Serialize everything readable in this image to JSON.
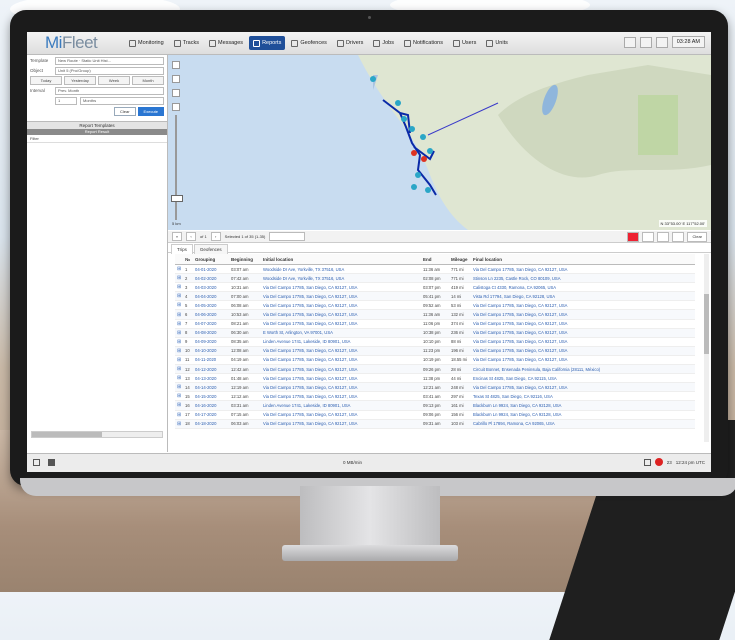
{
  "nav": {
    "logo_main": "Mi",
    "logo_tail": "Fleet",
    "items": [
      {
        "label": "Monitoring",
        "icon": "steering-wheel-icon"
      },
      {
        "label": "Tracks",
        "icon": "flag-icon"
      },
      {
        "label": "Messages",
        "icon": "messages-icon"
      },
      {
        "label": "Reports",
        "icon": "reports-icon",
        "active": true
      },
      {
        "label": "Geofences",
        "icon": "geofence-icon"
      },
      {
        "label": "Drivers",
        "icon": "drivers-icon"
      },
      {
        "label": "Jobs",
        "icon": "jobs-icon"
      },
      {
        "label": "Notifications",
        "icon": "bell-icon"
      },
      {
        "label": "Users",
        "icon": "users-icon"
      },
      {
        "label": "Units",
        "icon": "car-icon"
      }
    ],
    "clock": "03:28 AM"
  },
  "left_panel": {
    "template_label": "Template",
    "template_value": "New Route · Static Unit Hist...",
    "object_label": "Object",
    "object_value": "Unit 5 (Pro/Group)",
    "interval_label": "Interval",
    "interval_value": "Prev. Month",
    "period_buttons": [
      "Today",
      "Yesterday",
      "Week",
      "Month"
    ],
    "count_value": "1",
    "unit_value": "Months",
    "run_label": "Execute",
    "clear_label": "Clear",
    "templates_header": "Report Templates",
    "templates_sub": "Report Result",
    "filter_label": "Filter"
  },
  "map": {
    "scale": "5 km",
    "coords": "N 33°53.00' E 117°52.00'"
  },
  "grid_toolbar": {
    "page": "of 1",
    "selector": "Selected 1 of 35 (1-35)",
    "export_label": "Clear"
  },
  "tabs": [
    "Trips",
    "Geofences"
  ],
  "table": {
    "columns": [
      "№",
      "Grouping",
      "Beginning",
      "Initial location",
      "End",
      "Mileage",
      "Final location"
    ],
    "rows": [
      [
        "1",
        "04-01-2020",
        "03:07 am",
        "Woodside Dr Ave, Yorkville, TX 37516, USA",
        "11:36 am",
        "771 mi",
        "Via Del Campo 17785, San Diego, CA 92127, USA"
      ],
      [
        "2",
        "04-02-2020",
        "07:42 am",
        "Woodside Dr Ave, Yorkville, TX 37516, USA",
        "02:08 pm",
        "771 mi",
        "Stinson Ln 2235, Castle Rock, CO 80109, USA"
      ],
      [
        "3",
        "04-03-2020",
        "10:31 am",
        "Via Del Campo 17785, San Diego, CA 92127, USA",
        "03:07 pm",
        "419 mi",
        "Calistoga Ct 4330, Ramona, CA 92065, USA"
      ],
      [
        "4",
        "04-04-2020",
        "07:00 am",
        "Via Del Campo 17785, San Diego, CA 92127, USA",
        "05:41 pm",
        "14 mi",
        "Vista Rd 17794, San Diego, CA 92128, USA"
      ],
      [
        "5",
        "04-05-2020",
        "06:08 am",
        "Via Del Campo 17785, San Diego, CA 92127, USA",
        "09:52 am",
        "53 mi",
        "Via Del Campo 17785, San Diego, CA 92127, USA"
      ],
      [
        "6",
        "04-06-2020",
        "10:53 am",
        "Via Del Campo 17785, San Diego, CA 92127, USA",
        "11:36 am",
        "132 mi",
        "Via Del Campo 17785, San Diego, CA 92127, USA"
      ],
      [
        "7",
        "04-07-2020",
        "08:21 am",
        "Via Del Campo 17785, San Diego, CA 92127, USA",
        "11:06 pm",
        "374 mi",
        "Via Del Campo 17785, San Diego, CA 92127, USA"
      ],
      [
        "8",
        "04-08-2020",
        "06:30 am",
        "E Worth St, Arlington, VA 97001, USA",
        "10:38 pm",
        "236 mi",
        "Via Del Campo 17785, San Diego, CA 92127, USA"
      ],
      [
        "9",
        "04-09-2020",
        "08:35 am",
        "Linden Avenue 1741, Lakeside, ID 80901, USA",
        "10:10 pm",
        "88 mi",
        "Via Del Campo 17785, San Diego, CA 92127, USA"
      ],
      [
        "10",
        "04-10-2020",
        "12:08 am",
        "Via Del Campo 17785, San Diego, CA 92127, USA",
        "11:23 pm",
        "196 mi",
        "Via Del Campo 17785, San Diego, CA 92127, USA"
      ],
      [
        "11",
        "04-11-2020",
        "04:19 am",
        "Via Del Campo 17785, San Diego, CA 92127, USA",
        "10:19 pm",
        "18.55 mi",
        "Via Del Campo 17785, San Diego, CA 92127, USA"
      ],
      [
        "12",
        "04-12-2020",
        "12:42 am",
        "Via Del Campo 17785, San Diego, CA 92127, USA",
        "09:26 pm",
        "28 mi",
        "Circuit Bonnet, Ensenada Peninsula, Baja California (28111, México)"
      ],
      [
        "13",
        "04-13-2020",
        "01:48 am",
        "Via Del Campo 17785, San Diego, CA 92127, USA",
        "11:38 pm",
        "44 mi",
        "Encinas St 4825, San Diego, CA 92115, USA"
      ],
      [
        "14",
        "04-14-2020",
        "12:19 am",
        "Via Del Campo 17785, San Diego, CA 92127, USA",
        "12:21 am",
        "248 mi",
        "Via Del Campo 17785, San Diego, CA 92127, USA"
      ],
      [
        "15",
        "04-15-2020",
        "12:12 am",
        "Via Del Campo 17785, San Diego, CA 92127, USA",
        "03:41 am",
        "297 mi",
        "Texas St 4825, San Diego, CA 92116, USA"
      ],
      [
        "16",
        "04-16-2020",
        "03:31 am",
        "Linden Avenue 1741, Lakeside, ID 80901, USA",
        "09:13 pm",
        "161 mi",
        "Blackburn Ln 9924, San Diego, CA 92128, USA"
      ],
      [
        "17",
        "04-17-2020",
        "07:15 am",
        "Via Del Campo 17785, San Diego, CA 92127, USA",
        "09:06 pm",
        "156 mi",
        "Blackburn Ln 9924, San Diego, CA 92128, USA"
      ],
      [
        "18",
        "04-18-2020",
        "06:03 am",
        "Via Del Campo 17785, San Diego, CA 92127, USA",
        "09:31 am",
        "103 mi",
        "Cabrillo Pl 17894, Ramona, CA 92065, USA"
      ]
    ]
  },
  "status": {
    "center": "0 MB/min",
    "right": "12:24 pm UTC",
    "counter": "23"
  }
}
